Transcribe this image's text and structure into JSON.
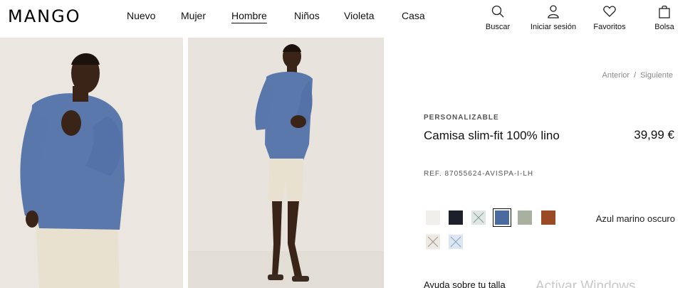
{
  "brand": "MANGO",
  "nav": {
    "items": [
      "Nuevo",
      "Mujer",
      "Hombre",
      "Niños",
      "Violeta",
      "Casa"
    ],
    "active": "Hombre"
  },
  "actions": {
    "search": "Buscar",
    "login": "Iniciar sesión",
    "favorites": "Favoritos",
    "bag": "Bolsa"
  },
  "breadcrumb": {
    "prev": "Anterior",
    "sep": "/",
    "next": "Siguiente"
  },
  "product": {
    "tag": "PERSONALIZABLE",
    "title": "Camisa slim-fit 100% lino",
    "price": "39,99 €",
    "ref": "REF. 87055624-AVISPA-I-LH",
    "selected_color": "Azul marino oscuro",
    "colors": [
      {
        "hex": "#f1efec",
        "available": true
      },
      {
        "hex": "#1d1f2a",
        "available": true
      },
      {
        "hex": "#dfe6e3",
        "available": false
      },
      {
        "hex": "#4a6aa0",
        "available": true,
        "selected": true
      },
      {
        "hex": "#a8b1a0",
        "available": true
      },
      {
        "hex": "#9a4a24",
        "available": true
      },
      {
        "hex": "#eee9e2",
        "available": false
      },
      {
        "hex": "#dde7f2",
        "available": false
      }
    ]
  },
  "help_link": "Ayuda sobre tu talla",
  "watermark": "Activar Windows"
}
